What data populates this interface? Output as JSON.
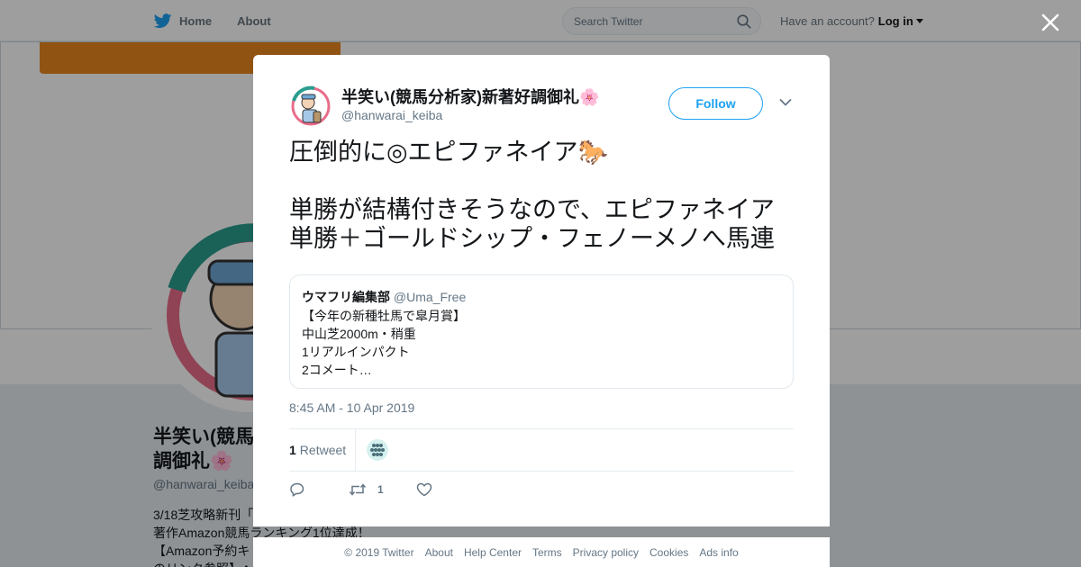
{
  "header": {
    "home_label": "Home",
    "about_label": "About",
    "search_placeholder": "Search Twitter",
    "account_prompt": "Have an account?",
    "login_label": "Log in"
  },
  "profile": {
    "name_line1": "半笑い(競馬",
    "name_line2": "調御礼🌸",
    "handle": "@hanwarai_keiba",
    "bio_line1": "3/18芝攻略新刊「",
    "bio_line2": "著作Amazon競馬ランキング1位達成！",
    "bio_line3": "【Amazon予約キ",
    "bio_line4": "のリンク参照】◆"
  },
  "tweet": {
    "author_name": "半笑い(競馬分析家)新著好調御礼🌸",
    "author_handle": "@hanwarai_keiba",
    "follow_label": "Follow",
    "text_line1": "圧倒的に◎エピファネイア🐎",
    "text_line2": "単勝が結構付きそうなので、エピファネイア",
    "text_line3": "単勝＋ゴールドシップ・フェノーメノへ馬連",
    "quote": {
      "name": "ウマフリ編集部",
      "handle": "@Uma_Free",
      "line1": "【今年の新種牡馬で皐月賞】",
      "line2": "中山芝2000m・稍重",
      "line3": "1リアルインパクト",
      "line4": "2コメート…"
    },
    "timestamp": "8:45 AM - 10 Apr 2019",
    "retweet_count": "1",
    "retweet_label": "Retweet",
    "action_retweet_count": "1"
  },
  "footer": {
    "copyright": "© 2019 Twitter",
    "about": "About",
    "help": "Help Center",
    "terms": "Terms",
    "privacy": "Privacy policy",
    "cookies": "Cookies",
    "ads": "Ads info"
  },
  "colors": {
    "twitter_blue": "#1da1f2",
    "banner_orange": "#e9871e",
    "muted_text": "#657786"
  }
}
